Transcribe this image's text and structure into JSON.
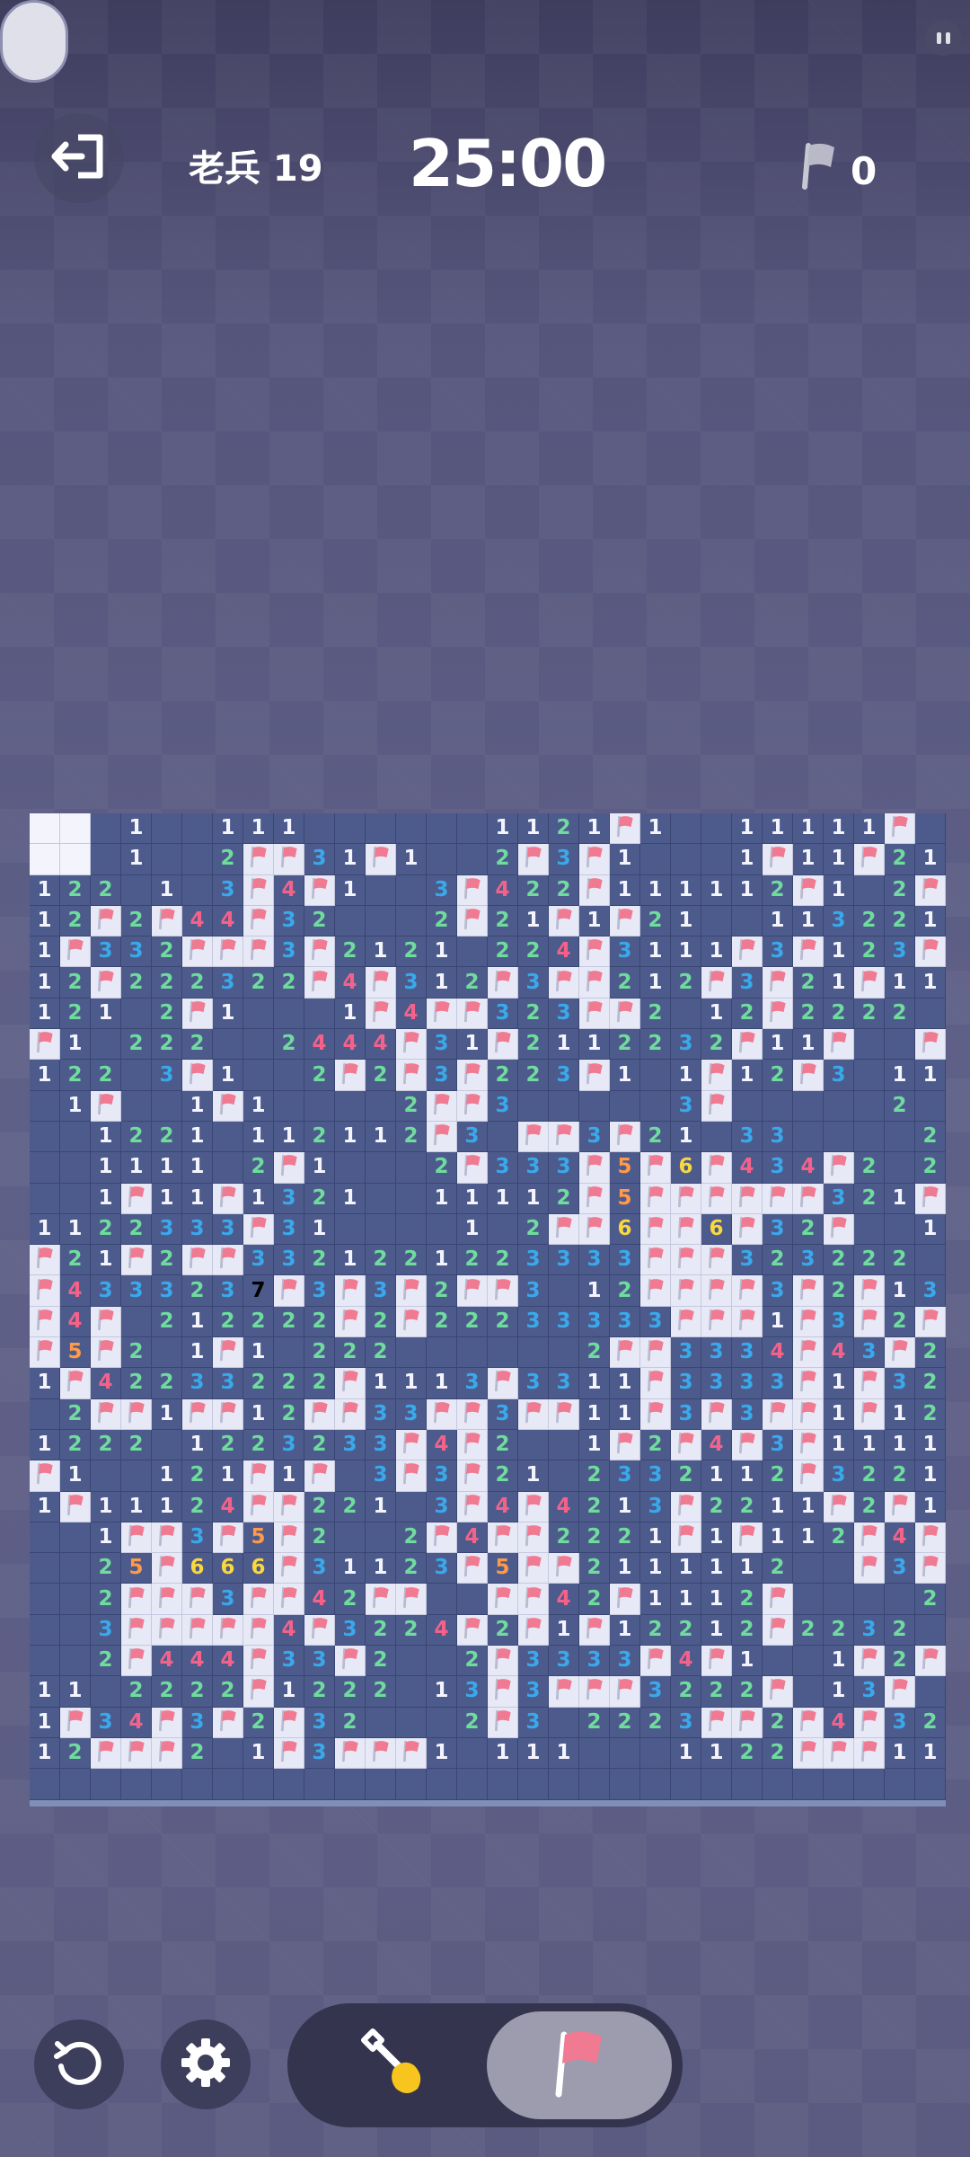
{
  "header": {
    "level_label": "老兵 19",
    "timer": "25:00",
    "flag_count": "0"
  },
  "icons": {
    "exit": "exit-icon",
    "side": "pause-icon",
    "flag": "flag-icon",
    "restart": "restart-icon",
    "settings": "gear-icon",
    "dig": "shovel-icon"
  },
  "controls": {
    "active_mode": "flag"
  },
  "colors": {
    "board": "#4d5b8c",
    "revealed": "#e7e9f7",
    "n1": "#f4f4ff",
    "n2": "#6fdc9e",
    "n3": "#39a9ec",
    "n4": "#f4628a",
    "n5": "#ff9a48",
    "n6": "#f8d83e",
    "flag": "#f07a92"
  },
  "board": {
    "cols": 30,
    "legend": "char per cell: '.' covered, 'F' flagged, '1'-'8' revealed number, 'H' highlighted revealed cell",
    "rows": [
      "HH.1..111......1121F1..11111F.",
      "HH.1..2FF31F1..2F3F1...1F11F21",
      "122.1.3F4F1..3F422F111112F1.2F",
      "12F2F44F32...2F21F1F21..113221",
      "1F332FFF3F2121.224F3111F3F123F",
      "12F222322F4F312F3FF212F3F21F11",
      "121.2F1...1F4FF323FF2.12F2222.",
      "F1.222..2444F31F2112232F11F..F",
      "122.3F1..2F2F3F223F1.1F12F3.11",
      ".1F..1F1....2FF3.....3F.....2.",
      "..1221.112112F3.FF3F21.33....2",
      "..1111.2F1...2F333F5F6F434F2.2",
      "..1F11F1321..11112F5FFFFFF321F",
      "1122333F31....1.2FF6FF6F32F..1",
      "F21F2FF3321221223333FFF323222.",
      "F4333237F3F3F2FF3.12FFFF3F2F13",
      "F4F.212222F2F22233333FFF1F3F2F",
      "F5F2.1F1.222......2FF3334F43F2",
      "1F42233222F1113F3311F3333F1F32",
      ".2FF1FF12FF33FF3FF11F3F3FF1F12",
      "1222.1223233F4F2..1F2F4F3F1111",
      "F1..121F1F.3F3F21.2332112F3221",
      "1F11124FF221.3F4F4213F2211F2F1",
      "..1FF3F5F2..2F4FF2221F1F112F4F",
      "..25F666F31123F5FF2111112..F3F",
      "..2FFF3FF42FF..FF42F1112F....2",
      "..3FFFFF4F3224F2F1F12212F2232.",
      "..2F444F33F2..2F3333F4F1..1F2F",
      "11.2222F1222.13F3FFF3222F.13F.",
      "1F34F3F2F32...2F3.2223FF2F4F32",
      "12FFF2.1F3FFF1.111...1122FFF11",
      ".............................."
    ]
  }
}
